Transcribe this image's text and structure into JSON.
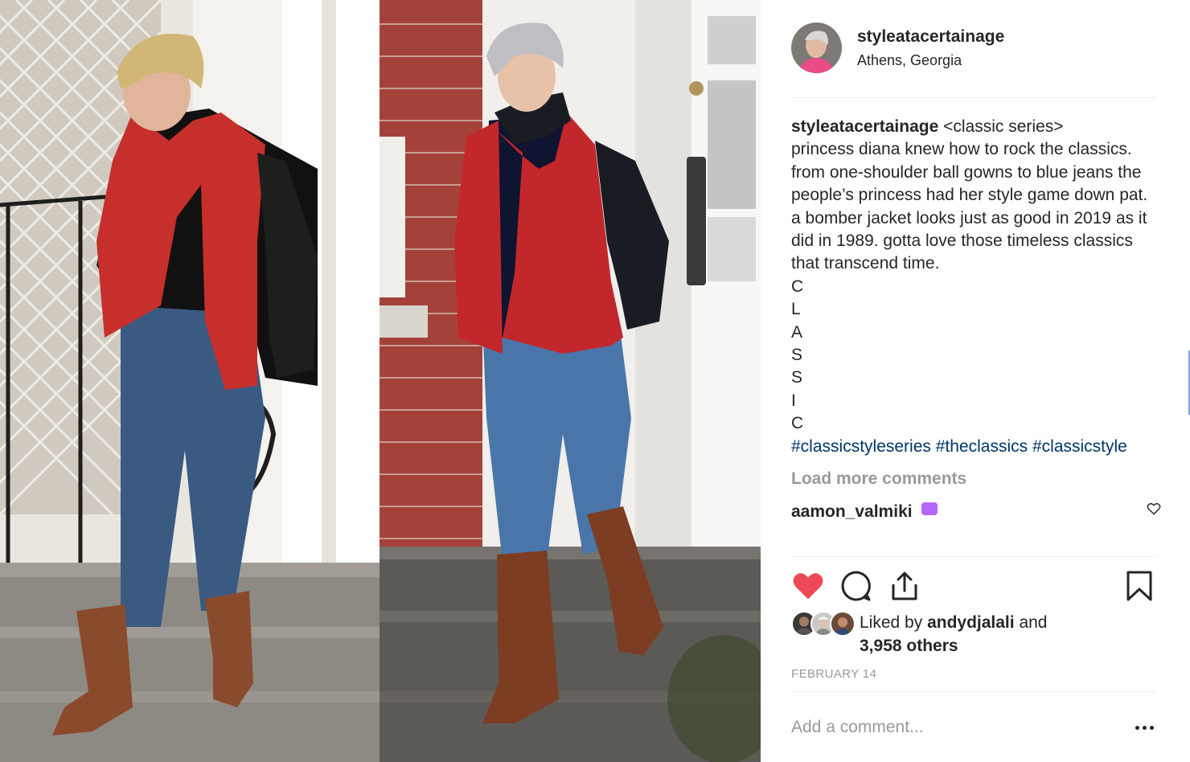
{
  "post": {
    "username": "styleatacertainage",
    "location": "Athens, Georgia"
  },
  "caption": {
    "username": "styleatacertainage",
    "text": "<classic series>\nprincess diana knew how to rock the classics. from one-shoulder ball gowns to blue jeans the people’s princess had her style game down pat. a bomber jacket looks just as good in 2019 as it did in 1989. gotta love those timeless classics that transcend time.\nC\nL\nA\nS\nS\nI\nC",
    "hashtags": [
      "#classicstyleseries",
      "#theclassics",
      "#classicstyle"
    ]
  },
  "load_more_label": "Load more comments",
  "peek_comment": {
    "username": "aamon_valmiki"
  },
  "actions": {
    "like_icon": "heart-filled-icon",
    "comment_icon": "comment-icon",
    "share_icon": "share-icon",
    "save_icon": "bookmark-icon"
  },
  "likes": {
    "prefix": "Liked by ",
    "user": "andydjalali",
    "and": " and",
    "others": "3,958 others"
  },
  "date": "FEBRUARY 14",
  "add_comment_placeholder": "Add a comment...",
  "colors": {
    "like_red": "#ed4956",
    "hashtag_blue": "#003569",
    "muted_gray": "#999999",
    "text": "#262626"
  }
}
